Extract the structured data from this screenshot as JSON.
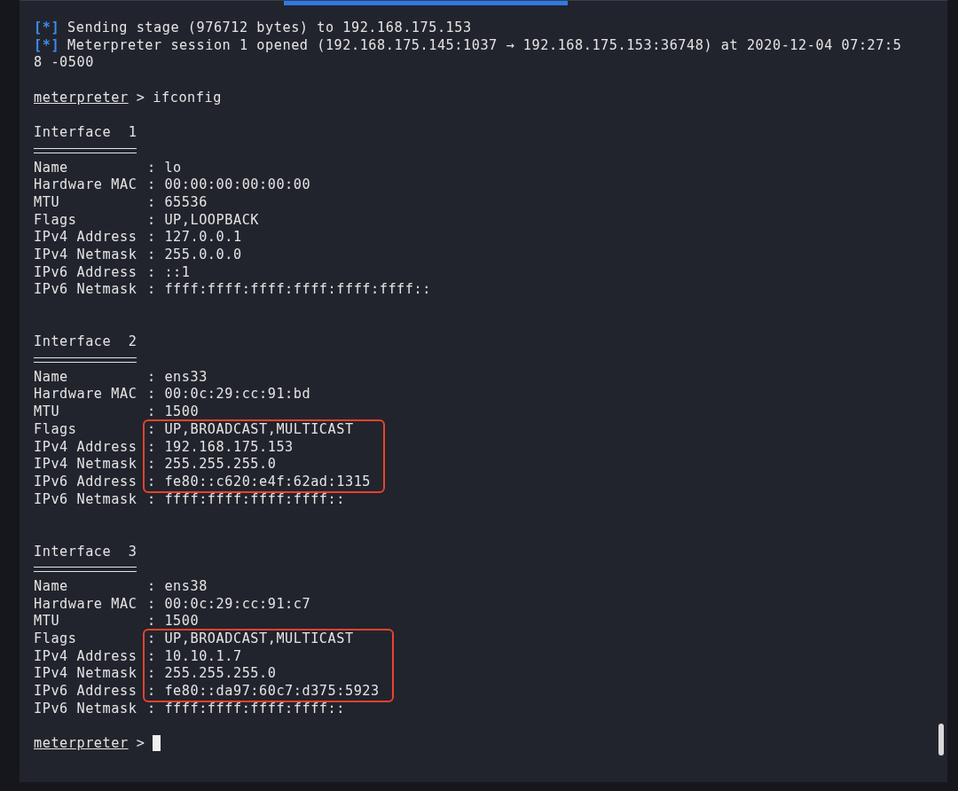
{
  "output": [
    {
      "kind": "status",
      "marker": "[*]",
      "text": "Sending stage (976712 bytes) to 192.168.175.153"
    },
    {
      "kind": "status",
      "marker": "[*]",
      "text": "Meterpreter session 1 opened (192.168.175.145:1037 → 192.168.175.153:36748) at 2020-12-04 07:27:5"
    },
    {
      "kind": "plain",
      "text": "8 -0500"
    },
    {
      "kind": "blank"
    },
    {
      "kind": "prompt",
      "prompt": "meterpreter",
      "separator": ">",
      "command": "ifconfig",
      "cursor": false
    },
    {
      "kind": "blank"
    },
    {
      "kind": "interface",
      "title": "Interface  1",
      "fields": [
        {
          "key": "Name",
          "value": ": lo",
          "highlighted": false
        },
        {
          "key": "Hardware MAC",
          "value": ": 00:00:00:00:00:00",
          "highlighted": false
        },
        {
          "key": "MTU",
          "value": ": 65536",
          "highlighted": false
        },
        {
          "key": "Flags",
          "value": ": UP,LOOPBACK",
          "highlighted": false
        },
        {
          "key": "IPv4 Address",
          "value": ": 127.0.0.1",
          "highlighted": false
        },
        {
          "key": "IPv4 Netmask",
          "value": ": 255.0.0.0",
          "highlighted": false
        },
        {
          "key": "IPv6 Address",
          "value": ": ::1",
          "highlighted": false
        },
        {
          "key": "IPv6 Netmask",
          "value": ": ffff:ffff:ffff:ffff:ffff:ffff::",
          "highlighted": false
        }
      ]
    },
    {
      "kind": "blank"
    },
    {
      "kind": "blank"
    },
    {
      "kind": "interface",
      "title": "Interface  2",
      "fields": [
        {
          "key": "Name",
          "value": ": ens33",
          "highlighted": false
        },
        {
          "key": "Hardware MAC",
          "value": ": 00:0c:29:cc:91:bd",
          "highlighted": false
        },
        {
          "key": "MTU",
          "value": ": 1500",
          "highlighted": false
        },
        {
          "key": "Flags",
          "value": ": UP,BROADCAST,MULTICAST",
          "highlighted": true
        },
        {
          "key": "IPv4 Address",
          "value": ": 192.168.175.153",
          "highlighted": true
        },
        {
          "key": "IPv4 Netmask",
          "value": ": 255.255.255.0",
          "highlighted": true
        },
        {
          "key": "IPv6 Address",
          "value": ": fe80::c620:e4f:62ad:1315",
          "highlighted": true
        },
        {
          "key": "IPv6 Netmask",
          "value": ": ffff:ffff:ffff:ffff::",
          "highlighted": false
        }
      ]
    },
    {
      "kind": "blank"
    },
    {
      "kind": "blank"
    },
    {
      "kind": "interface",
      "title": "Interface  3",
      "fields": [
        {
          "key": "Name",
          "value": ": ens38",
          "highlighted": false
        },
        {
          "key": "Hardware MAC",
          "value": ": 00:0c:29:cc:91:c7",
          "highlighted": false
        },
        {
          "key": "MTU",
          "value": ": 1500",
          "highlighted": false
        },
        {
          "key": "Flags",
          "value": ": UP,BROADCAST,MULTICAST",
          "highlighted": true
        },
        {
          "key": "IPv4 Address",
          "value": ": 10.10.1.7",
          "highlighted": true
        },
        {
          "key": "IPv4 Netmask",
          "value": ": 255.255.255.0",
          "highlighted": true
        },
        {
          "key": "IPv6 Address",
          "value": ": fe80::da97:60c7:d375:5923",
          "highlighted": true
        },
        {
          "key": "IPv6 Netmask",
          "value": ": ffff:ffff:ffff:ffff::",
          "highlighted": false
        }
      ]
    },
    {
      "kind": "blank"
    },
    {
      "kind": "prompt",
      "prompt": "meterpreter",
      "separator": ">",
      "cursor": true
    }
  ]
}
